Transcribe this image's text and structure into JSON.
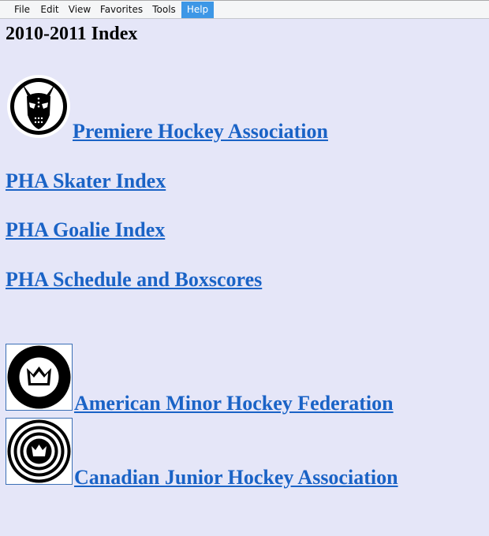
{
  "menu": {
    "items": [
      {
        "label": "File"
      },
      {
        "label": "Edit"
      },
      {
        "label": "View"
      },
      {
        "label": "Favorites"
      },
      {
        "label": "Tools"
      },
      {
        "label": "Help",
        "active": true
      }
    ]
  },
  "page": {
    "title": "2010-2011 Index",
    "links": {
      "pha": "Premiere Hockey Association",
      "skater_index": "PHA Skater Index",
      "goalie_index": "PHA Goalie Index",
      "schedule": "PHA Schedule and Boxscores",
      "amhf": "American Minor Hockey Federation",
      "cjha": "Canadian Junior Hockey Association"
    }
  },
  "colors": {
    "background": "#e5e6f8",
    "link": "#1a63c6",
    "menu_active": "#3d97e6"
  },
  "icons": {
    "pha_logo": "goalie-mask-devil-logo",
    "amhf_logo": "crown-circle-logo",
    "cjha_logo": "crown-concentric-rings-logo"
  }
}
